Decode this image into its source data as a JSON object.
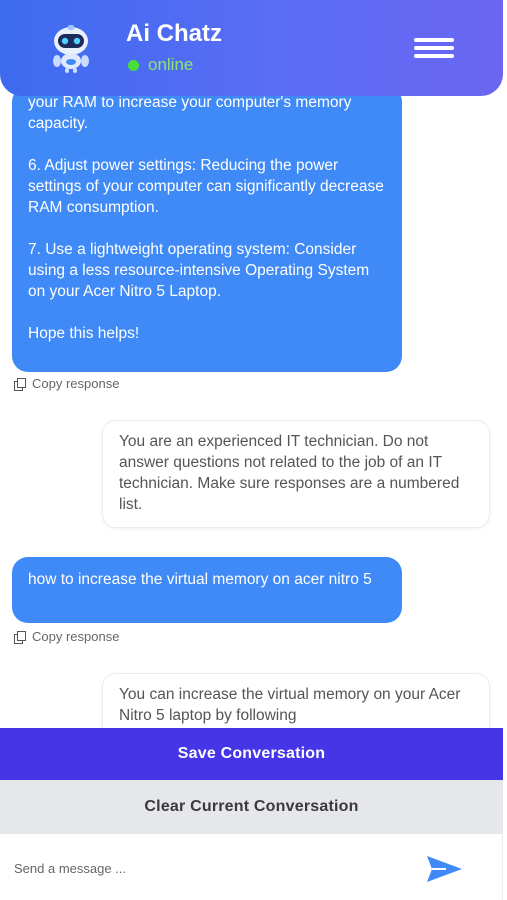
{
  "header": {
    "title": "Ai Chatz",
    "status": "online",
    "avatar_icon": "robot-icon",
    "menu_icon": "hamburger-menu-icon",
    "gradient_start": "#3d6bf0",
    "gradient_end": "#6b66f2"
  },
  "messages": {
    "bot1": {
      "lines": [
        "your RAM to increase your computer's memory capacity.",
        "6. Adjust power settings: Reducing the power settings of your computer can significantly decrease RAM consumption.",
        "7. Use a lightweight operating system: Consider using a less resource-intensive Operating System on your Acer Nitro 5 Laptop.",
        "Hope this helps!"
      ],
      "copy_label": "Copy response"
    },
    "user1": {
      "text": "You are an experienced IT technician. Do not answer questions not related to the job of an IT technician. Make sure responses are a numbered list."
    },
    "bot2": {
      "text": "how to increase the virtual memory on acer nitro 5",
      "copy_label": "Copy response"
    },
    "user2": {
      "text": "You can increase the virtual memory on your Acer Nitro 5 laptop by following"
    }
  },
  "actions": {
    "save_label": "Save Conversation",
    "clear_label": "Clear Current Conversation"
  },
  "composer": {
    "placeholder": "Send a message ...",
    "send_icon": "send-icon"
  },
  "colors": {
    "bot_bubble": "#3f8af7",
    "save_button": "#4535e6",
    "clear_button": "#e6e7ea",
    "online": "#4ade3a"
  }
}
